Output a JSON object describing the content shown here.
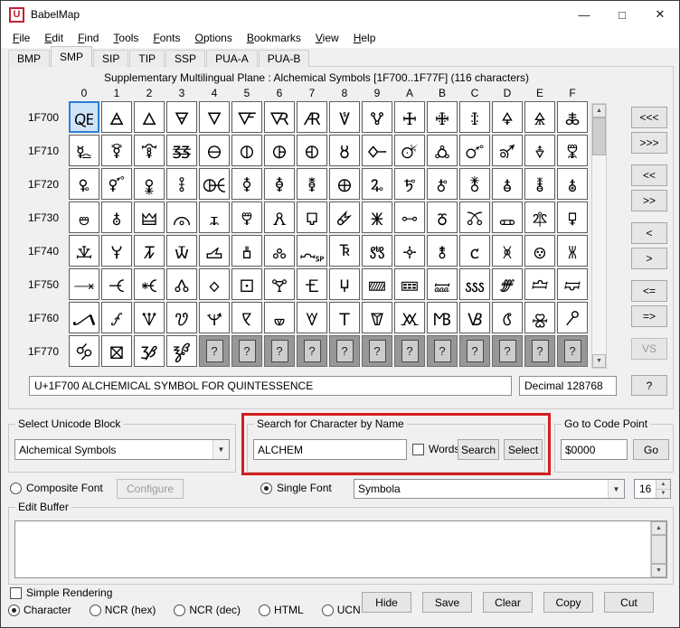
{
  "window": {
    "title": "BabelMap",
    "icon_letter": "U",
    "controls": {
      "minimize": "—",
      "maximize": "□",
      "close": "✕"
    }
  },
  "menu": {
    "items": [
      "File",
      "Edit",
      "Find",
      "Tools",
      "Fonts",
      "Options",
      "Bookmarks",
      "View",
      "Help"
    ]
  },
  "tabs": {
    "items": [
      "BMP",
      "SMP",
      "SIP",
      "TIP",
      "SSP",
      "PUA-A",
      "PUA-B"
    ],
    "active": "SMP"
  },
  "plane": {
    "header": "Supplementary Multilingual Plane : Alchemical Symbols [1F700..1F77F] (116 characters)",
    "col_headers": [
      "0",
      "1",
      "2",
      "3",
      "4",
      "5",
      "6",
      "7",
      "8",
      "9",
      "A",
      "B",
      "C",
      "D",
      "E",
      "F"
    ],
    "rows": [
      {
        "label": "1F700",
        "chars": "🜀🜁🜂🜃🜄🜅🜆🜇🜈🜉🜊🜋🜌🜍🜎🜏"
      },
      {
        "label": "1F710",
        "chars": "🜐🜑🜒🜓🜔🜕🜖🜗🜘🜙🜚🜛🜜🜝🜞🜟"
      },
      {
        "label": "1F720",
        "chars": "🜠🜡🜢🜣🜤🜥🜦🜧🜨🜩🜪🜫🜬🜭🜮🜯"
      },
      {
        "label": "1F730",
        "chars": "🜰🜱🜲🜳🜴🜵🜶🜷🜸🜹🜺🜻🜼🜽🜾🜿"
      },
      {
        "label": "1F740",
        "chars": "🝀🝁🝂🝃🝄🝅🝆🝇🝈🝉🝊🝋🝌🝍🝎🝏"
      },
      {
        "label": "1F750",
        "chars": "🝐🝑🝒🝓🝔🝕🝖🝗🝘🝙🝚🝛🝜🝝🝞🝟"
      },
      {
        "label": "1F760",
        "chars": "🝠🝡🝢🝣🝤🝥🝦🝧🝨🝩🝪🝫🝬🝭🝮🝯"
      },
      {
        "label": "1F770",
        "chars": "🝰🝱🝲🝳"
      }
    ],
    "selected_cell": {
      "row": 0,
      "col": 0
    },
    "reserved_glyph": "?",
    "nav_buttons": [
      {
        "label": "<<<"
      },
      {
        "label": ">>>"
      },
      {
        "label": "<<"
      },
      {
        "label": ">>"
      },
      {
        "label": "<"
      },
      {
        "label": ">"
      },
      {
        "label": "<="
      },
      {
        "label": "=>"
      },
      {
        "label": "VS",
        "disabled": true
      }
    ],
    "help_label": "?",
    "status": {
      "char_name": "U+1F700 ALCHEMICAL SYMBOL FOR QUINTESSENCE",
      "decimal": "Decimal 128768"
    }
  },
  "block_group": {
    "legend": "Select Unicode Block",
    "value": "Alchemical Symbols"
  },
  "search_group": {
    "legend": "Search for Character by Name",
    "query": "ALCHEM",
    "words_label": "Words",
    "words_checked": false,
    "search_label": "Search",
    "select_label": "Select"
  },
  "codepoint_group": {
    "legend": "Go to Code Point",
    "value": "$0000",
    "go_label": "Go"
  },
  "font_row": {
    "composite_label": "Composite Font",
    "configure_label": "Configure",
    "configure_disabled": true,
    "single_label": "Single Font",
    "single_selected": true,
    "font_name": "Symbola",
    "size": "16"
  },
  "edit_buffer": {
    "legend": "Edit Buffer",
    "content": ""
  },
  "bottom": {
    "simple_rendering_label": "Simple Rendering",
    "simple_rendering_checked": false,
    "modes": [
      {
        "label": "Character",
        "checked": true
      },
      {
        "label": "NCR (hex)",
        "checked": false
      },
      {
        "label": "NCR (dec)",
        "checked": false
      },
      {
        "label": "HTML",
        "checked": false
      },
      {
        "label": "UCN",
        "checked": false
      }
    ],
    "buttons": [
      "Hide",
      "Save",
      "Clear",
      "Copy",
      "Cut"
    ]
  },
  "colors": {
    "selection_border": "#2a7fd4",
    "selection_fill": "#cfe4f7",
    "annotation": "#d21e1e",
    "title_icon": "#c32330"
  }
}
